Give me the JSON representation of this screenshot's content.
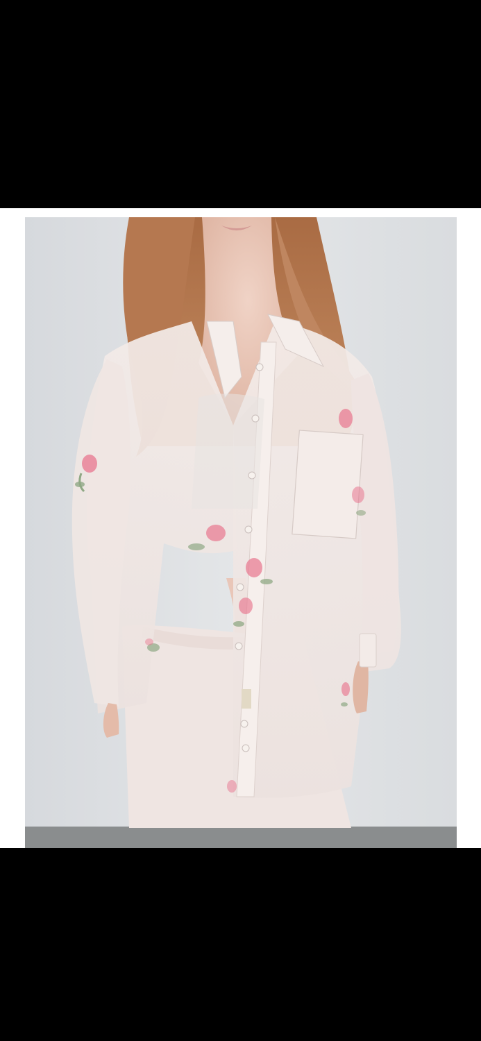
{
  "viewer": {
    "background_color": "#000000",
    "frame_color": "#ffffff"
  },
  "photo": {
    "subject": "product-photo",
    "colors": {
      "wall": "#dfe1e4",
      "floor": "#8a8d8e",
      "hair": "#b77a52",
      "skin": "#e8c4b4",
      "fabric": "#f1e6e3",
      "rose": "#e8768f",
      "leaf": "#8fa884",
      "button": "#f7f2ee"
    }
  }
}
